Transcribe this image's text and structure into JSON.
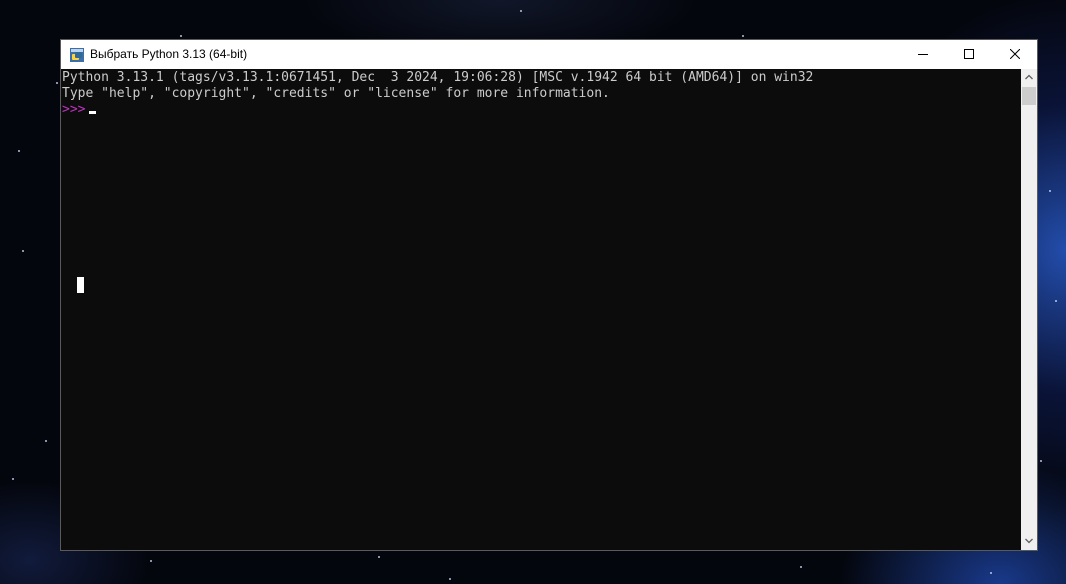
{
  "window": {
    "title": "Выбрать Python 3.13 (64-bit)"
  },
  "titlebar_buttons": {
    "minimize_icon": "minimize-icon",
    "maximize_icon": "maximize-icon",
    "close_icon": "close-icon"
  },
  "console": {
    "line1": "Python 3.13.1 (tags/v3.13.1:0671451, Dec  3 2024, 19:06:28) [MSC v.1942 64 bit (AMD64)] on win32",
    "line2": "Type \"help\", \"copyright\", \"credits\" or \"license\" for more information.",
    "prompt": ">>>",
    "input": ""
  },
  "colors": {
    "console_background": "#0c0c0c",
    "console_text": "#cccccc",
    "prompt": "#c233c2",
    "titlebar": "#ffffff",
    "scrollbar_track": "#f0f0f0",
    "scrollbar_thumb": "#cdcdcd"
  },
  "scrollbar": {
    "position": 0
  }
}
